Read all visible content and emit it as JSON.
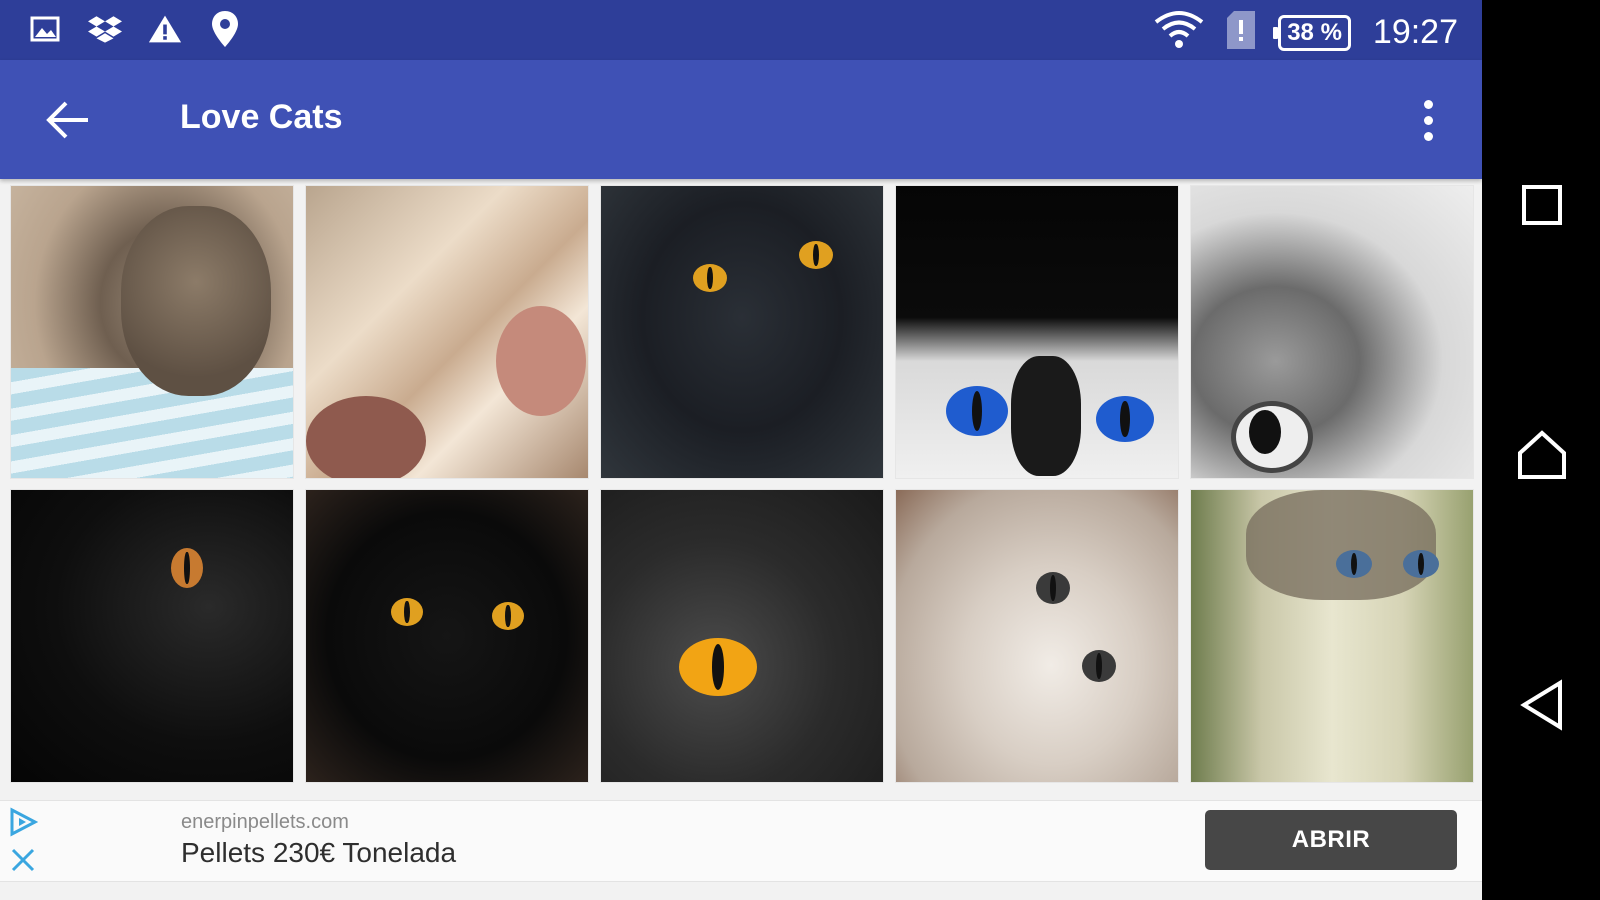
{
  "status_bar": {
    "left_icons": [
      "gallery-icon",
      "dropbox-icon",
      "warning-icon",
      "location-pin-icon"
    ],
    "right_icons": [
      "wifi-icon",
      "sim-alert-icon",
      "battery-icon"
    ],
    "battery": "38 %",
    "time": "19:27"
  },
  "app_bar": {
    "title": "Love Cats",
    "background": "#3f51b5",
    "status_background": "#2e3e99"
  },
  "gallery": {
    "items": [
      {
        "subject": "fluffy kitten on blue towel"
      },
      {
        "subject": "tabby cats close-up"
      },
      {
        "subject": "black cat with amber eyes"
      },
      {
        "subject": "black and white cat with blue eyes"
      },
      {
        "subject": "grey tabby kitten black and white"
      },
      {
        "subject": "black long-haired cat profile"
      },
      {
        "subject": "black fluffy cat with amber eyes"
      },
      {
        "subject": "grey cat amber eye close-up"
      },
      {
        "subject": "light kitten playing"
      },
      {
        "subject": "tabby kitten with blue eyes"
      }
    ]
  },
  "ad": {
    "domain": "enerpinpellets.com",
    "headline": "Pellets 230€ Tonelada",
    "button": "ABRIR",
    "button_color": "#474747"
  },
  "nav_bar": {
    "buttons": [
      "recents-icon",
      "home-icon",
      "back-triangle-icon"
    ]
  }
}
